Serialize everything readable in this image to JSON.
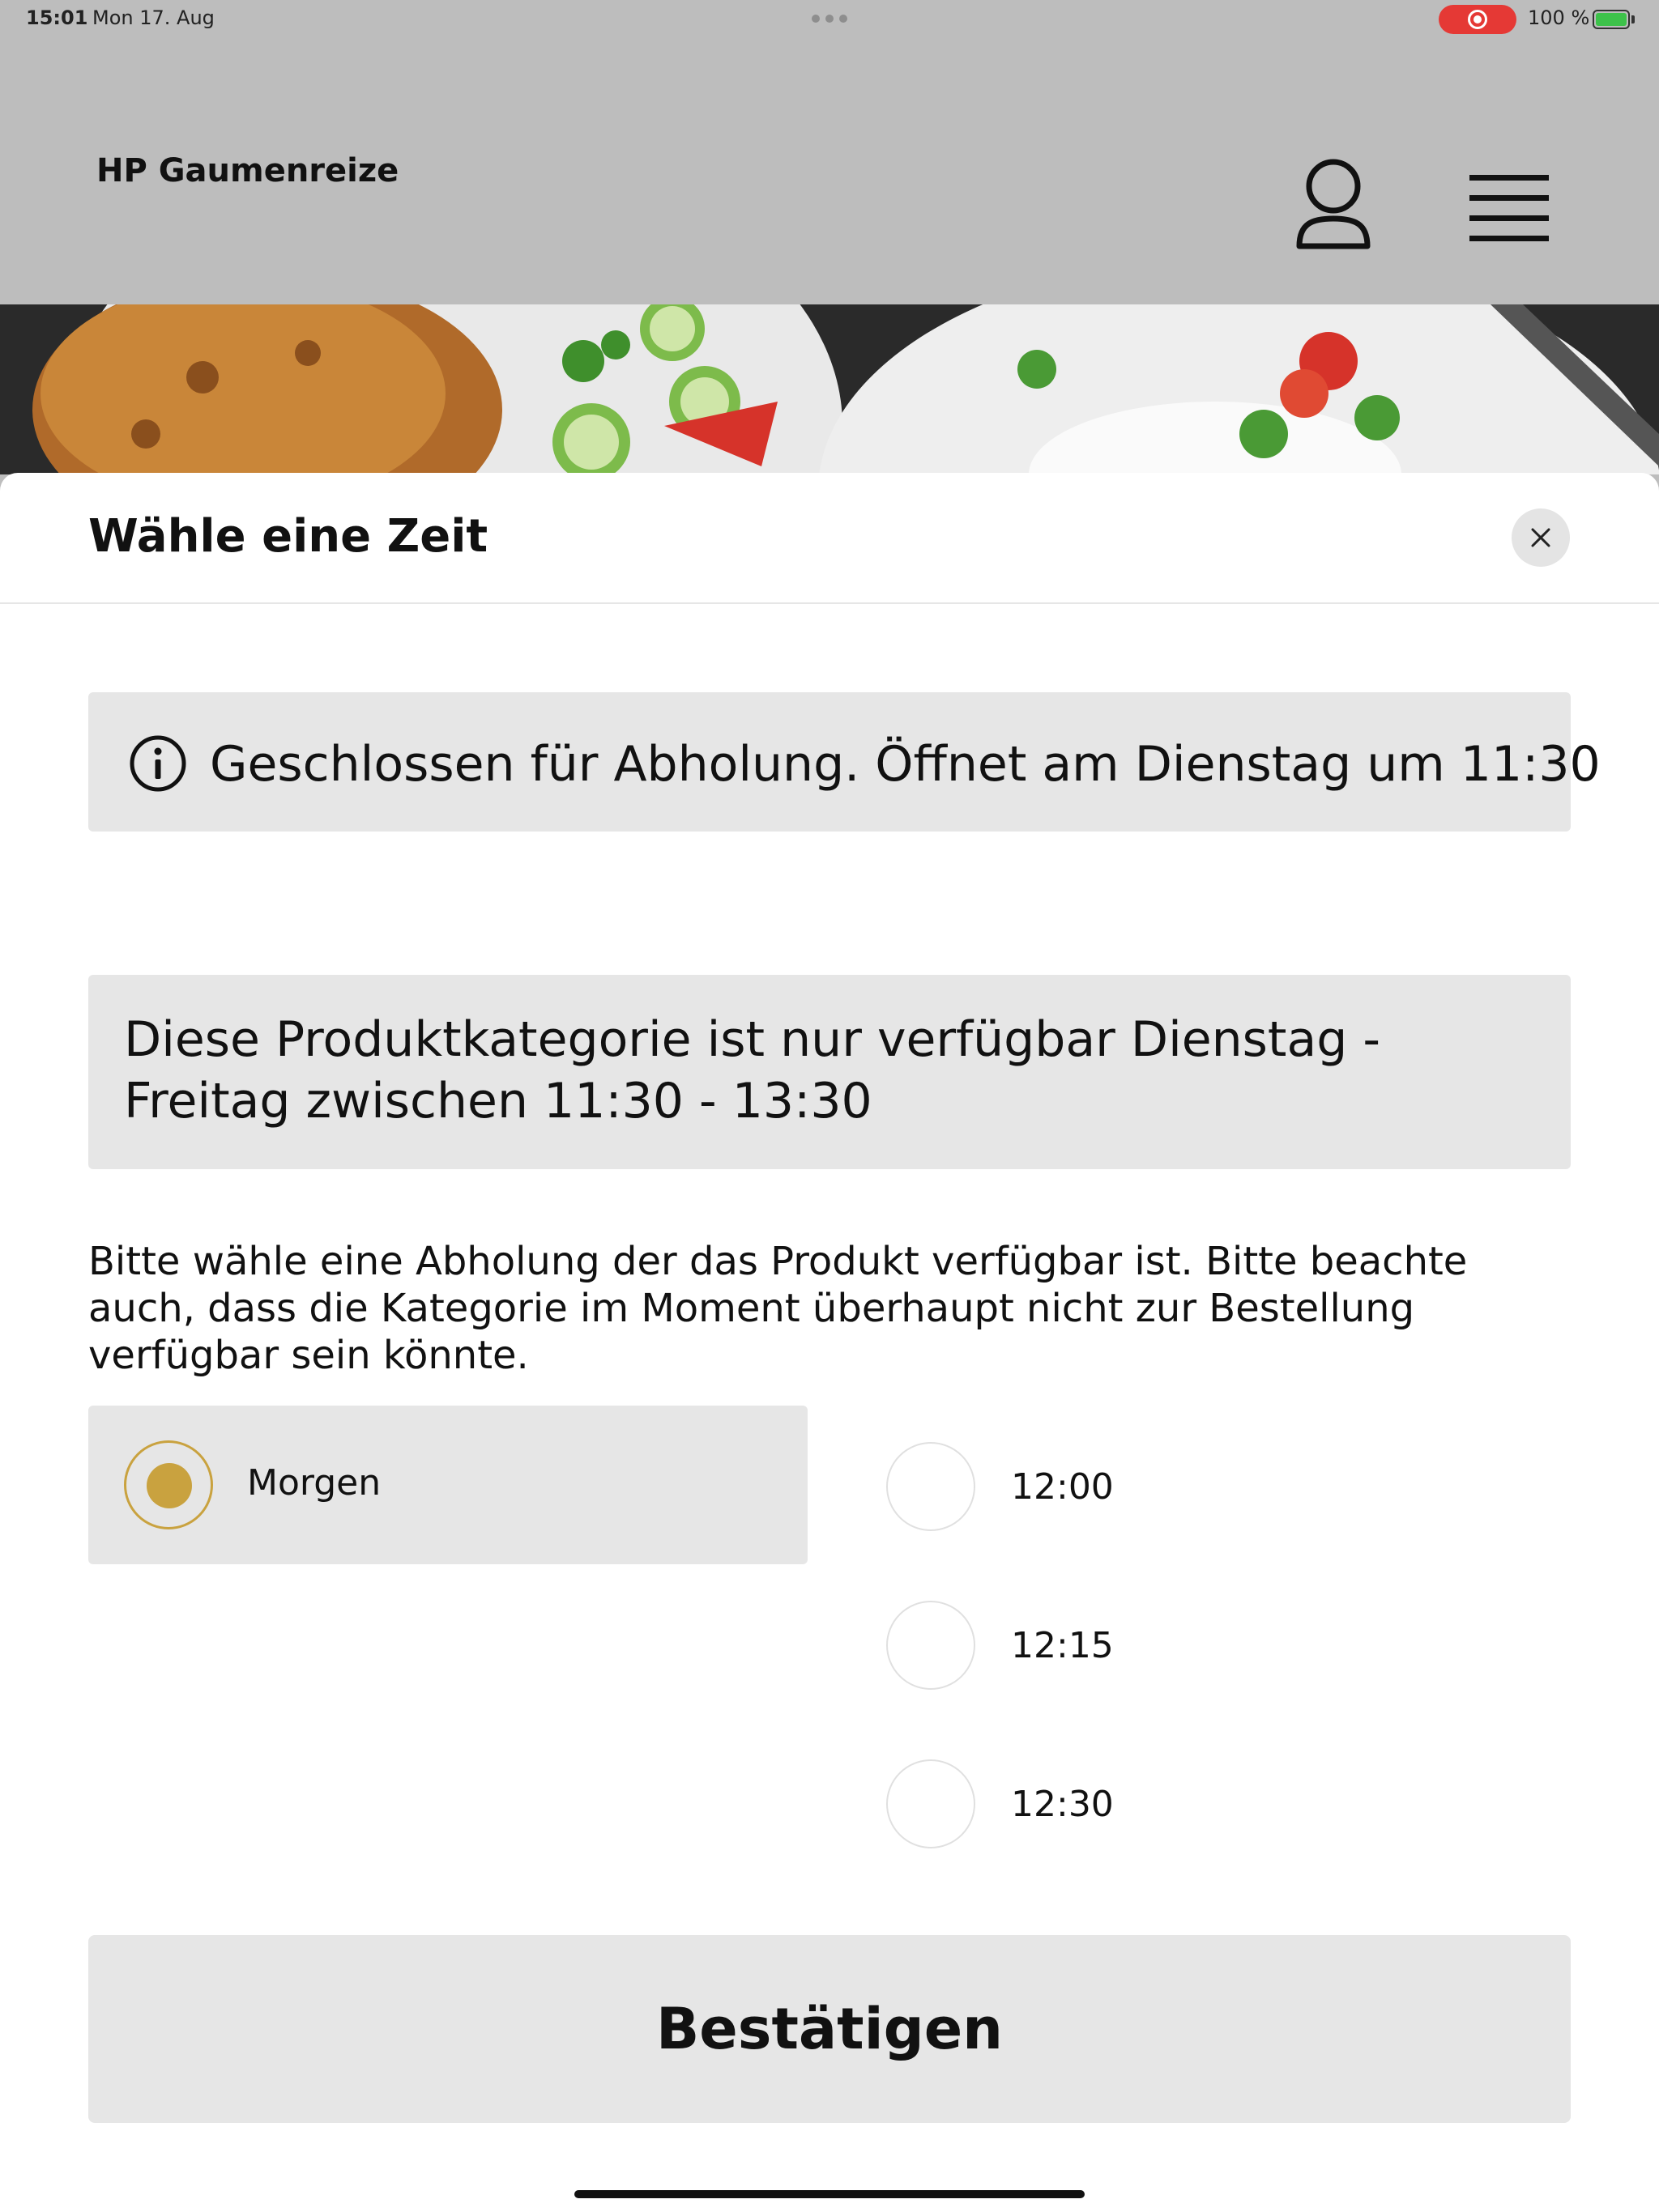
{
  "status_bar": {
    "time": "15:01",
    "date": "Mon 17. Aug",
    "battery": "100 %"
  },
  "header": {
    "brand": "HP Gaumenreize",
    "profile_icon": "person-icon",
    "menu_icon": "hamburger-menu-icon"
  },
  "modal": {
    "title": "Wähle eine Zeit",
    "close_icon": "close-icon",
    "notice": "Geschlossen für Abholung. Öffnet am Dienstag um 11:30",
    "category_notice": "Diese Produktkategorie ist nur verfügbar Dienstag - Freitag zwischen 11:30 - 13:30",
    "hint": "Bitte wähle eine Abholung der das Produkt verfügbar ist. Bitte beachte auch, dass die Kategorie im Moment überhaupt nicht zur Bestellung verfügbar sein könnte.",
    "day_options": [
      {
        "label": "Morgen",
        "selected": true
      }
    ],
    "time_options": [
      {
        "label": "12:00",
        "selected": false
      },
      {
        "label": "12:15",
        "selected": false
      },
      {
        "label": "12:30",
        "selected": false
      }
    ],
    "confirm_label": "Bestätigen"
  },
  "colors": {
    "accent": "#c9a23f",
    "header_bg": "#bdbdbd",
    "panel_bg": "#e6e6e6",
    "record_red": "#e53935"
  }
}
